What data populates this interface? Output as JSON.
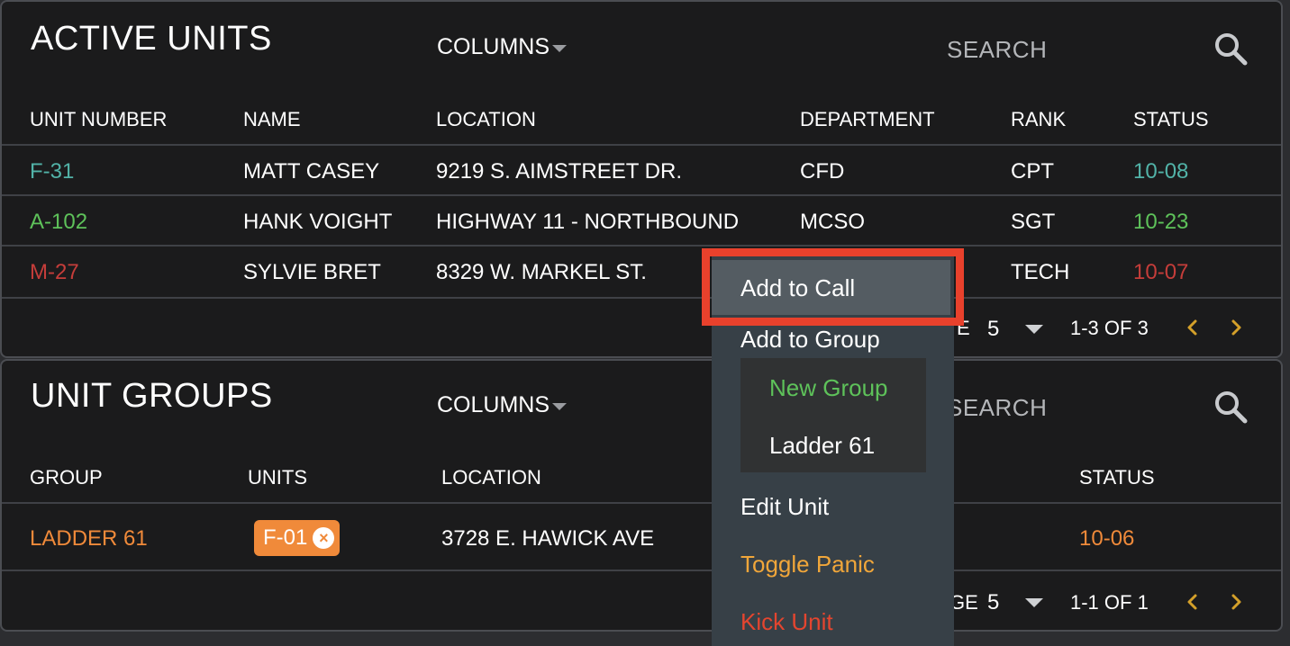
{
  "colors": {
    "panel_bg": "#1b1b1c",
    "accent_green": "#5ec25a",
    "status_teal": "#52b3a8",
    "status_green": "#5ec25a",
    "status_red": "#c53d3a",
    "status_orange": "#f08a3a",
    "menu_bg": "#374047",
    "highlight_red": "#e8412c",
    "toggle_panic": "#f0a63a",
    "kick_unit": "#e4452f",
    "chevron": "#d4a02a"
  },
  "active_units": {
    "title": "ACTIVE UNITS",
    "columns_label": "COLUMNS",
    "search_placeholder": "SEARCH",
    "headers": [
      "UNIT NUMBER",
      "NAME",
      "LOCATION",
      "DEPARTMENT",
      "RANK",
      "STATUS"
    ],
    "rows": [
      {
        "unit": "F-31",
        "name": "MATT CASEY",
        "location": "9219 S. AIMSTREET DR.",
        "department": "CFD",
        "rank": "CPT",
        "status": "10-08",
        "color": "#52b3a8"
      },
      {
        "unit": "A-102",
        "name": "HANK VOIGHT",
        "location": "HIGHWAY 11 - NORTHBOUND",
        "department": "MCSO",
        "rank": "SGT",
        "status": "10-23",
        "color": "#5ec25a"
      },
      {
        "unit": "M-27",
        "name": "SYLVIE BRET",
        "location": "8329 W. MARKEL ST.",
        "department": "",
        "rank": "TECH",
        "status": "10-07",
        "color": "#c53d3a"
      }
    ],
    "pagination": {
      "rows_per_page_label": "E",
      "rows_per_page": "5",
      "range": "1-3 OF 3"
    }
  },
  "unit_groups": {
    "title": "UNIT GROUPS",
    "columns_label": "COLUMNS",
    "search_placeholder": "SEARCH",
    "headers": [
      "GROUP",
      "UNITS",
      "LOCATION",
      "STATUS"
    ],
    "rows": [
      {
        "group": "LADDER 61",
        "unit_chip": "F-01",
        "location": "3728 E. HAWICK AVE",
        "status": "10-06",
        "color": "#f08a3a"
      }
    ],
    "pagination": {
      "rows_per_page_label": "GE",
      "rows_per_page": "5",
      "range": "1-1 OF 1"
    }
  },
  "context_menu": {
    "add_to_call": "Add to Call",
    "add_to_group": "Add to Group",
    "submenu": {
      "new_group": "New Group",
      "ladder_61": "Ladder 61"
    },
    "edit_unit": "Edit Unit",
    "toggle_panic": "Toggle Panic",
    "kick_unit": "Kick Unit"
  }
}
